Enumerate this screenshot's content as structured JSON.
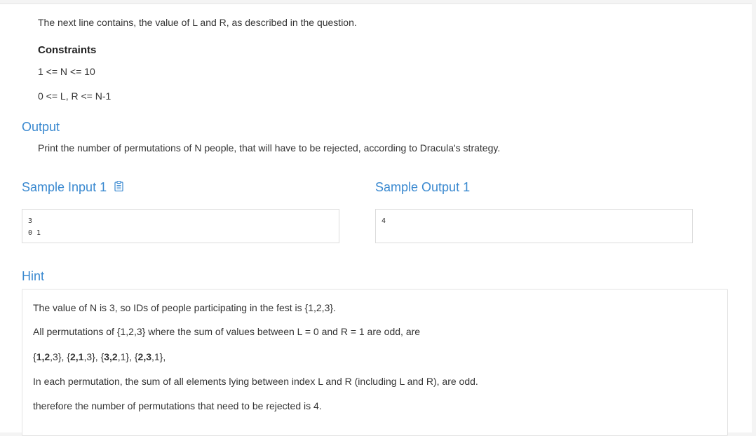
{
  "input_desc": "The next line contains, the value of L and R, as described in the question.",
  "constraints": {
    "title": "Constraints",
    "lines": [
      "1 <= N <= 10",
      "0 <= L, R <= N-1"
    ]
  },
  "output": {
    "title": "Output",
    "text": "Print the number of permutations of N people, that will have to be rejected, according to Dracula's strategy."
  },
  "sample_input": {
    "title": "Sample Input 1",
    "lines": [
      "3",
      "0 1"
    ]
  },
  "sample_output": {
    "title": "Sample Output 1",
    "lines": [
      "4"
    ]
  },
  "hint": {
    "title": "Hint",
    "line1": "The value of N is 3, so IDs of people participating in the fest is {1,2,3}.",
    "line2": "All permutations of {1,2,3} where the sum of values between L = 0 and R = 1 are odd, are",
    "perm_parts": [
      "{",
      "1,2",
      ",3}, {",
      "2,1",
      ",3}, {",
      "3,2",
      ",1}, {",
      "2,3",
      ",1},"
    ],
    "line4": "In each permutation, the sum of all elements lying between index L and R (including L and R), are odd.",
    "line5": "therefore the number of permutations that need to be rejected is 4."
  },
  "colors": {
    "heading": "#3a89d0",
    "icon": "#3a89d0",
    "text": "#333333"
  }
}
